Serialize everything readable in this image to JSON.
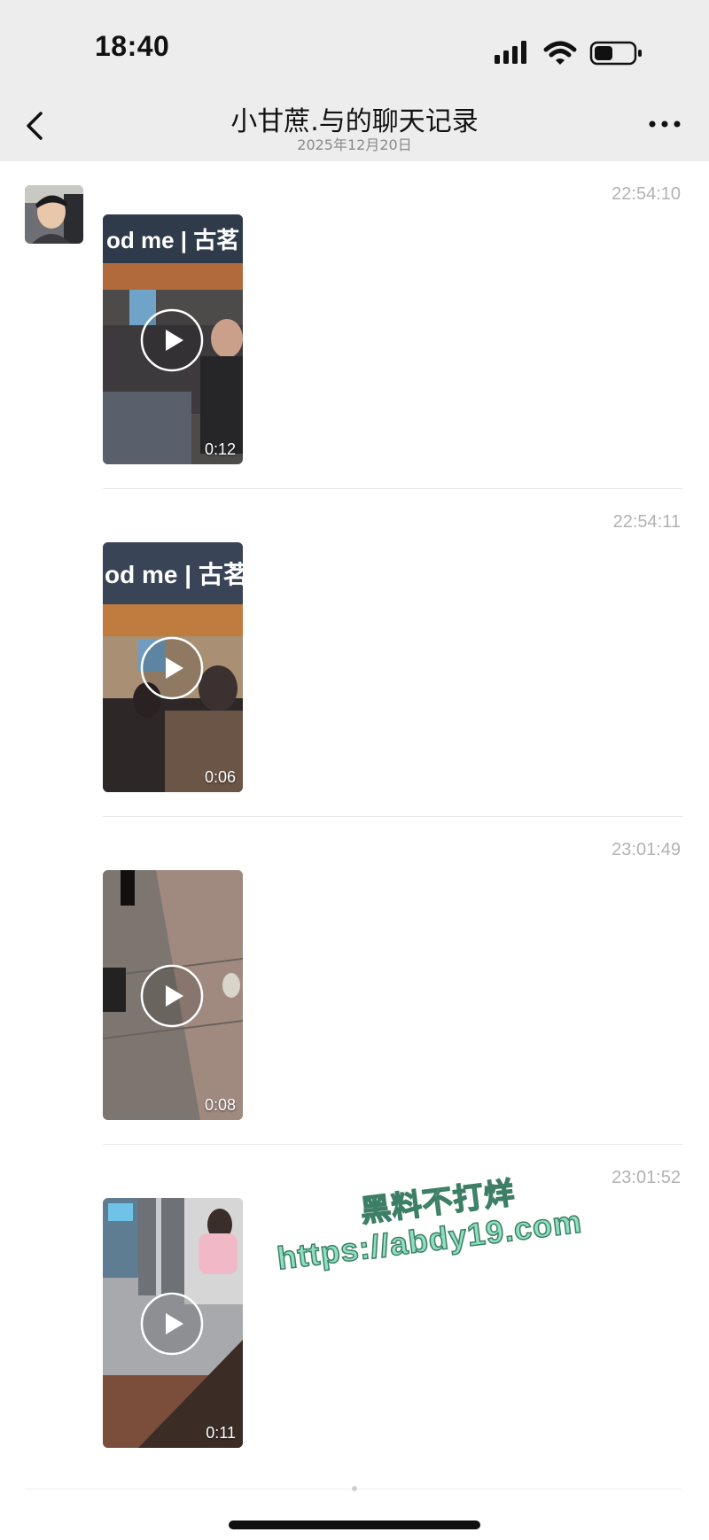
{
  "status_bar": {
    "time": "18:40",
    "icons": [
      "signal-icon",
      "wifi-icon",
      "battery-icon"
    ]
  },
  "nav": {
    "title": "小甘蔗.与的聊天记录",
    "subtitle": "2025年12月20日",
    "back_icon": "chevron-left-icon",
    "more_icon": "more-dots-icon"
  },
  "messages": [
    {
      "time": "22:54:10",
      "type": "video",
      "duration": "0:12",
      "thumb_sign_text": "od me | 古茗"
    },
    {
      "time": "22:54:11",
      "type": "video",
      "duration": "0:06",
      "thumb_sign_text": "od me | 古茗"
    },
    {
      "time": "23:01:49",
      "type": "video",
      "duration": "0:08"
    },
    {
      "time": "23:01:52",
      "type": "video",
      "duration": "0:11"
    }
  ],
  "watermark": {
    "line1": "黑料不打烊",
    "line2": "https://abdy19.com"
  },
  "colors": {
    "header_bg": "#ededed",
    "time_text": "#b2b2b2",
    "watermark_fill": "#8ee0c0"
  }
}
